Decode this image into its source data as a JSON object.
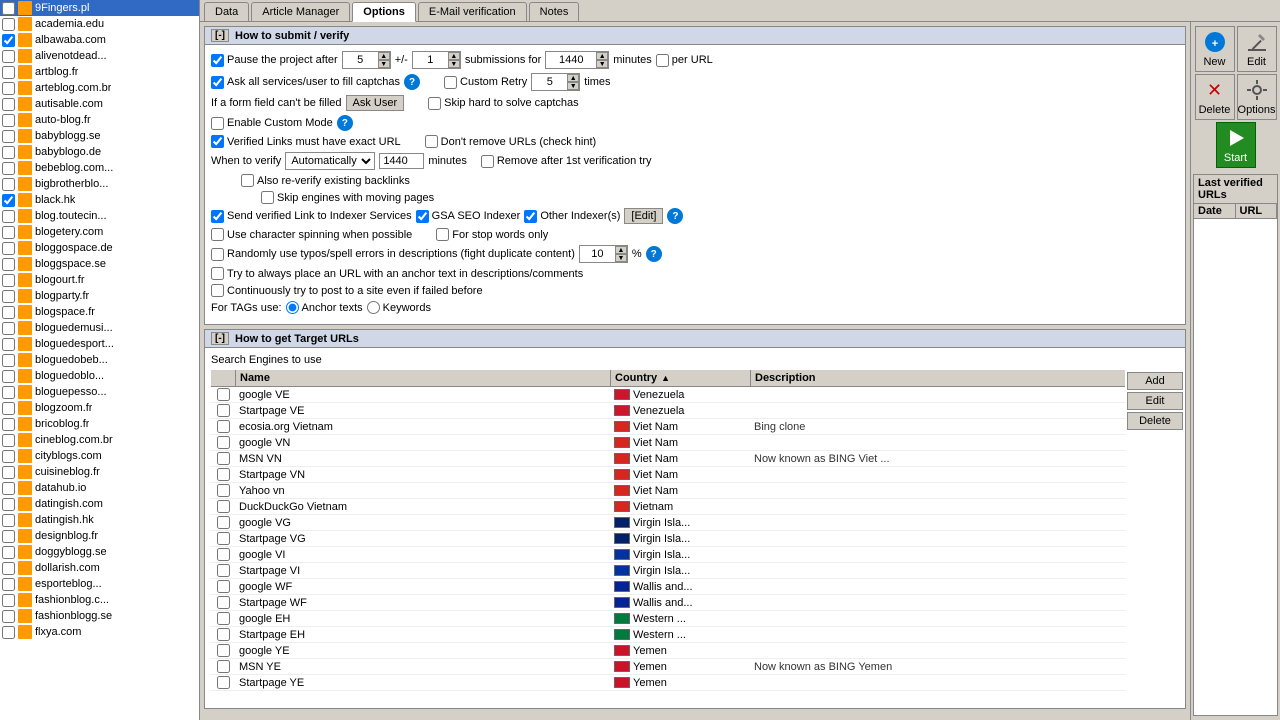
{
  "tabs": [
    "Data",
    "Article Manager",
    "Options",
    "E-Mail verification",
    "Notes"
  ],
  "active_tab": "Options",
  "left_panel": {
    "items": [
      {
        "label": "9Fingers.pl",
        "checked": false,
        "selected": false
      },
      {
        "label": "academia.edu",
        "checked": false,
        "selected": false
      },
      {
        "label": "albawaba.com",
        "checked": true,
        "selected": false
      },
      {
        "label": "alivenotdead...",
        "checked": false,
        "selected": false
      },
      {
        "label": "artblog.fr",
        "checked": false,
        "selected": false
      },
      {
        "label": "arteblog.com.br",
        "checked": false,
        "selected": false
      },
      {
        "label": "autisable.com",
        "checked": false,
        "selected": false
      },
      {
        "label": "auto-blog.fr",
        "checked": false,
        "selected": false
      },
      {
        "label": "babyblogg.se",
        "checked": false,
        "selected": false
      },
      {
        "label": "babyblogo.de",
        "checked": false,
        "selected": false
      },
      {
        "label": "bebeblog.com...",
        "checked": false,
        "selected": false
      },
      {
        "label": "bigbrotherblo...",
        "checked": false,
        "selected": false
      },
      {
        "label": "black.hk",
        "checked": true,
        "selected": false
      },
      {
        "label": "blog.toutecin...",
        "checked": false,
        "selected": false
      },
      {
        "label": "blogetery.com",
        "checked": false,
        "selected": false
      },
      {
        "label": "bloggospace.de",
        "checked": false,
        "selected": false
      },
      {
        "label": "bloggspace.se",
        "checked": false,
        "selected": false
      },
      {
        "label": "blogourt.fr",
        "checked": false,
        "selected": false
      },
      {
        "label": "blogparty.fr",
        "checked": false,
        "selected": false
      },
      {
        "label": "blogspace.fr",
        "checked": false,
        "selected": false
      },
      {
        "label": "bloguedemusi...",
        "checked": false,
        "selected": false
      },
      {
        "label": "bloguedesport...",
        "checked": false,
        "selected": false
      },
      {
        "label": "bloguedobeb...",
        "checked": false,
        "selected": false
      },
      {
        "label": "bloguedoblo...",
        "checked": false,
        "selected": false
      },
      {
        "label": "bloguepesso...",
        "checked": false,
        "selected": false
      },
      {
        "label": "blogzoom.fr",
        "checked": false,
        "selected": false
      },
      {
        "label": "bricoblog.fr",
        "checked": false,
        "selected": false
      },
      {
        "label": "cineblog.com.br",
        "checked": false,
        "selected": false
      },
      {
        "label": "cityblogs.com",
        "checked": false,
        "selected": false
      },
      {
        "label": "cuisineblog.fr",
        "checked": false,
        "selected": false
      },
      {
        "label": "datahub.io",
        "checked": false,
        "selected": false
      },
      {
        "label": "datingish.com",
        "checked": false,
        "selected": false
      },
      {
        "label": "datingish.hk",
        "checked": false,
        "selected": false
      },
      {
        "label": "designblog.fr",
        "checked": false,
        "selected": false
      },
      {
        "label": "doggyblogg.se",
        "checked": false,
        "selected": false
      },
      {
        "label": "dollarish.com",
        "checked": false,
        "selected": false
      },
      {
        "label": "esporteblog...",
        "checked": false,
        "selected": false
      },
      {
        "label": "fashionblog.c...",
        "checked": false,
        "selected": false
      },
      {
        "label": "fashionblogg.se",
        "checked": false,
        "selected": false
      },
      {
        "label": "flxya.com",
        "checked": false,
        "selected": false
      }
    ]
  },
  "toolbar": {
    "new_label": "New",
    "edit_label": "Edit",
    "delete_label": "Delete",
    "options_label": "Options",
    "start_label": "Start"
  },
  "last_verified": {
    "title": "Last verified URLs",
    "col_date": "Date",
    "col_url": "URL"
  },
  "how_to_submit": {
    "title": "How to submit / verify",
    "pause_label": "Pause the project after",
    "pause_value": "5",
    "pause_step": "1",
    "submissions_label": "submissions for",
    "submissions_value": "1440",
    "minutes_label": "minutes",
    "per_url_label": "per URL",
    "ask_captcha_label": "Ask all services/user to fill captchas",
    "form_fill_label": "If a form field can't be filled",
    "ask_user_label": "Ask User",
    "custom_retry_label": "Custom Retry",
    "custom_retry_value": "5",
    "times_label": "times",
    "skip_captcha_label": "Skip hard to solve captchas",
    "enable_custom_label": "Enable Custom Mode",
    "verified_links_label": "Verified Links must have exact URL",
    "dont_remove_label": "Don't remove URLs (check hint)",
    "remove_after_label": "Remove after 1st verification try",
    "when_to_verify_label": "When to verify",
    "when_to_verify_value": "Automatically",
    "minutes2_value": "1440",
    "re_verify_label": "Also re-verify existing backlinks",
    "skip_engines_label": "Skip engines with moving pages",
    "send_verified_label": "Send verified Link to Indexer Services",
    "gsa_seo_label": "GSA SEO Indexer",
    "other_indexers_label": "Other Indexer(s)",
    "edit_label": "[Edit]",
    "char_spinning_label": "Use character spinning when possible",
    "for_stop_label": "For stop words only",
    "random_typos_label": "Randomly use typos/spell errors in descriptions (fight duplicate content)",
    "typos_value": "10",
    "anchor_text_label": "Try to always place an URL with an anchor text in descriptions/comments",
    "continuously_label": "Continuously try to post to a site even if failed before",
    "for_tags_label": "For TAGs use:",
    "anchor_tags_label": "Anchor texts",
    "keywords_label": "Keywords"
  },
  "how_to_get_urls": {
    "title": "How to get Target URLs",
    "search_engines_label": "Search Engines to use",
    "col_name": "Name",
    "col_country": "Country",
    "col_desc": "Description",
    "add_label": "Add",
    "edit_label": "Edit",
    "delete_label": "Delete",
    "engines": [
      {
        "checked": false,
        "name": "google VE",
        "country": "Venezuela",
        "flag_color": "#CF142B",
        "description": ""
      },
      {
        "checked": false,
        "name": "Startpage VE",
        "country": "Venezuela",
        "flag_color": "#CF142B",
        "description": ""
      },
      {
        "checked": false,
        "name": "ecosia.org Vietnam",
        "country": "Viet Nam",
        "flag_color": "#DA251D",
        "description": "Bing clone"
      },
      {
        "checked": false,
        "name": "google VN",
        "country": "Viet Nam",
        "flag_color": "#DA251D",
        "description": ""
      },
      {
        "checked": false,
        "name": "MSN VN",
        "country": "Viet Nam",
        "flag_color": "#DA251D",
        "description": "Now known as BING Viet ..."
      },
      {
        "checked": false,
        "name": "Startpage VN",
        "country": "Viet Nam",
        "flag_color": "#DA251D",
        "description": ""
      },
      {
        "checked": false,
        "name": "Yahoo vn",
        "country": "Viet Nam",
        "flag_color": "#DA251D",
        "description": ""
      },
      {
        "checked": false,
        "name": "DuckDuckGo Vietnam",
        "country": "Vietnam",
        "flag_color": "#DA251D",
        "description": ""
      },
      {
        "checked": false,
        "name": "google VG",
        "country": "Virgin Isla...",
        "flag_color": "#012169",
        "description": ""
      },
      {
        "checked": false,
        "name": "Startpage VG",
        "country": "Virgin Isla...",
        "flag_color": "#012169",
        "description": ""
      },
      {
        "checked": false,
        "name": "google VI",
        "country": "Virgin Isla...",
        "flag_color": "#0033A0",
        "description": ""
      },
      {
        "checked": false,
        "name": "Startpage VI",
        "country": "Virgin Isla...",
        "flag_color": "#0033A0",
        "description": ""
      },
      {
        "checked": false,
        "name": "google WF",
        "country": "Wallis and...",
        "flag_color": "#002395",
        "description": ""
      },
      {
        "checked": false,
        "name": "Startpage WF",
        "country": "Wallis and...",
        "flag_color": "#002395",
        "description": ""
      },
      {
        "checked": false,
        "name": "google EH",
        "country": "Western ...",
        "flag_color": "#007A3D",
        "description": ""
      },
      {
        "checked": false,
        "name": "Startpage EH",
        "country": "Western ...",
        "flag_color": "#007A3D",
        "description": ""
      },
      {
        "checked": false,
        "name": "google YE",
        "country": "Yemen",
        "flag_color": "#CE1126",
        "description": ""
      },
      {
        "checked": false,
        "name": "MSN YE",
        "country": "Yemen",
        "flag_color": "#CE1126",
        "description": "Now known as BING Yemen"
      },
      {
        "checked": false,
        "name": "Startpage YE",
        "country": "Yemen",
        "flag_color": "#CE1126",
        "description": ""
      }
    ]
  }
}
